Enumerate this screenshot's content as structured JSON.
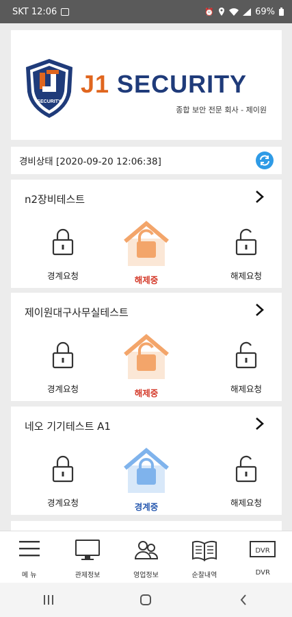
{
  "status_bar": {
    "carrier_time": "SKT 12:06",
    "battery": "69%"
  },
  "brand": {
    "name_accent": "J1",
    "name_main": " SECURITY",
    "shield_text": "SECURITY",
    "tagline": "종합 보안 전문 회사 - 제이원",
    "colors": {
      "navy": "#1f3b7a",
      "orange": "#e0661f",
      "blue": "#2f9be6"
    }
  },
  "guard_status": {
    "text": "경비상태 [2020-09-20 12:06:38]"
  },
  "sites": [
    {
      "name": "n2장비테스트",
      "left_action": "경계요청",
      "state": "해제중",
      "right_action": "해제요청",
      "state_color": "orange"
    },
    {
      "name": "제이원대구사무실테스트",
      "left_action": "경계요청",
      "state": "해제중",
      "right_action": "해제요청",
      "state_color": "orange"
    },
    {
      "name": "네오 기기테스트 A1",
      "left_action": "경계요청",
      "state": "경계중",
      "right_action": "해제요청",
      "state_color": "blue"
    }
  ],
  "bottom_nav": [
    {
      "label": "메 뉴",
      "icon": "menu-icon"
    },
    {
      "label": "관제정보",
      "icon": "monitor-icon"
    },
    {
      "label": "영업정보",
      "icon": "users-icon"
    },
    {
      "label": "순찰내역",
      "icon": "book-icon"
    },
    {
      "label": "DVR",
      "icon": "dvr-icon"
    }
  ],
  "dvr_icon_text": "DVR"
}
